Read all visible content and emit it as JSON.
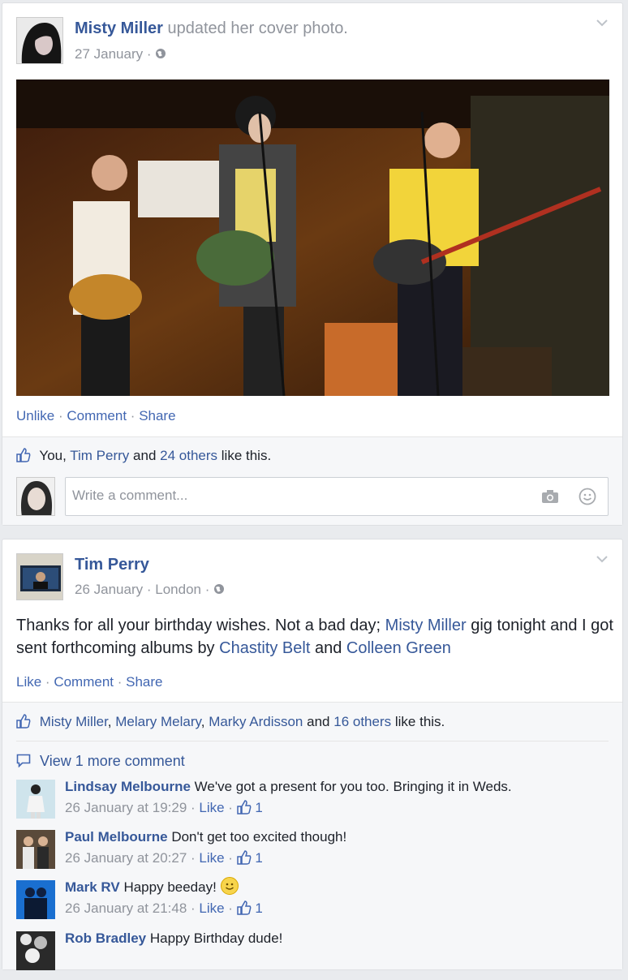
{
  "post1": {
    "author": "Misty Miller",
    "action": "updated her cover photo.",
    "date": "27 January",
    "separator": "·",
    "actions": {
      "like": "Unlike",
      "comment": "Comment",
      "share": "Share"
    },
    "likes": {
      "you": "You,",
      "person": "Tim Perry",
      "and": "and",
      "others": "24 others",
      "suffix": "like this."
    },
    "comment_placeholder": "Write a comment..."
  },
  "post2": {
    "author": "Tim Perry",
    "date": "26 January",
    "location": "London",
    "text": {
      "part1": "Thanks for all your birthday wishes. Not a bad day; ",
      "link1": "Misty Miller",
      "part2": " gig tonight and I got sent forthcoming albums by ",
      "link2": "Chastity Belt",
      "part3": " and ",
      "link3": "Colleen Green"
    },
    "actions": {
      "like": "Like",
      "comment": "Comment",
      "share": "Share"
    },
    "likes": {
      "p1": "Misty Miller",
      "p2": "Melary Melary",
      "p3": "Marky Ardisson",
      "and": "and",
      "others": "16 others",
      "suffix": "like this."
    },
    "view_more": "View 1 more comment",
    "comments": [
      {
        "name": "Lindsay Melbourne",
        "text": "We've got a present for you too. Bringing it in Weds.",
        "time": "26 January at 19:29",
        "like": "Like",
        "count": "1"
      },
      {
        "name": "Paul Melbourne",
        "text": "Don't get too excited though!",
        "time": "26 January at 20:27",
        "like": "Like",
        "count": "1"
      },
      {
        "name": "Mark RV",
        "text": "Happy beeday!",
        "time": "26 January at 21:48",
        "like": "Like",
        "count": "1"
      },
      {
        "name": "Rob Bradley",
        "text": "Happy Birthday dude!"
      }
    ]
  }
}
